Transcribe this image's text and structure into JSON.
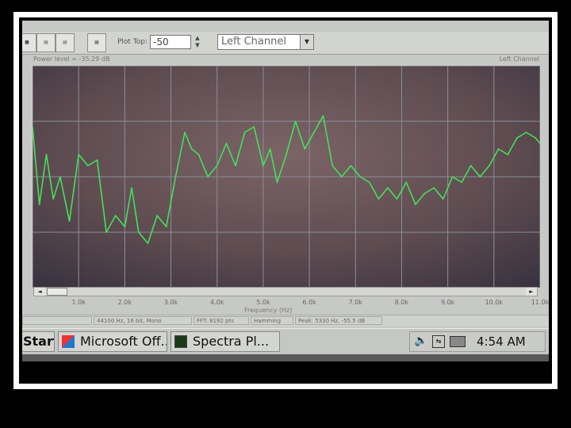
{
  "toolbar": {
    "plot_top_label": "Plot Top:",
    "plot_top_value": "-50",
    "channel_select": "Left Channel"
  },
  "plot": {
    "power_level": "Power level = -35.29 dB",
    "channel_label": "Left Channel",
    "xlabel": "Frequency (Hz)",
    "x_ticks": [
      "1.0k",
      "2.0k",
      "3.0k",
      "4.0k",
      "5.0k",
      "6.0k",
      "7.0k",
      "8.0k",
      "9.0k",
      "10.0k",
      "11.0k"
    ]
  },
  "status_bar": {
    "format": "44100 Hz, 16 bit, Mono",
    "fft": "FFT: 8192 pts",
    "window": "Hamming",
    "peak": "Peak: 5330 Hz, -55.5 dB"
  },
  "taskbar": {
    "start_label": "Start",
    "items": [
      "Microsoft Off...",
      "Spectra Pl..."
    ],
    "clock": "4:54 AM"
  },
  "chart_data": {
    "type": "line",
    "xlabel": "Frequency (Hz)",
    "xlim": [
      0,
      11000
    ],
    "ylim": [
      0,
      4
    ],
    "grid": true,
    "series": [
      {
        "color": "#45e05a",
        "x": [
          0,
          150,
          300,
          450,
          600,
          800,
          1000,
          1200,
          1400,
          1600,
          1800,
          2000,
          2150,
          2300,
          2500,
          2700,
          2900,
          3100,
          3300,
          3450,
          3600,
          3800,
          4000,
          4200,
          4400,
          4600,
          4800,
          5000,
          5150,
          5300,
          5500,
          5700,
          5900,
          6100,
          6300,
          6500,
          6700,
          6900,
          7100,
          7300,
          7500,
          7700,
          7900,
          8100,
          8300,
          8500,
          8700,
          8900,
          9100,
          9300,
          9500,
          9700,
          9900,
          10100,
          10300,
          10500,
          10700,
          10900,
          11000
        ],
        "y": [
          2.9,
          1.5,
          2.4,
          1.6,
          2.0,
          1.2,
          2.4,
          2.2,
          2.3,
          1.0,
          1.3,
          1.1,
          1.8,
          1.0,
          0.8,
          1.3,
          1.1,
          2.0,
          2.8,
          2.5,
          2.4,
          2.0,
          2.2,
          2.6,
          2.2,
          2.8,
          2.9,
          2.2,
          2.5,
          1.9,
          2.4,
          3.0,
          2.5,
          2.8,
          3.1,
          2.2,
          2.0,
          2.2,
          2.0,
          1.9,
          1.6,
          1.8,
          1.6,
          1.9,
          1.5,
          1.7,
          1.8,
          1.6,
          2.0,
          1.9,
          2.2,
          2.0,
          2.2,
          2.5,
          2.4,
          2.7,
          2.8,
          2.7,
          2.6
        ]
      }
    ]
  }
}
